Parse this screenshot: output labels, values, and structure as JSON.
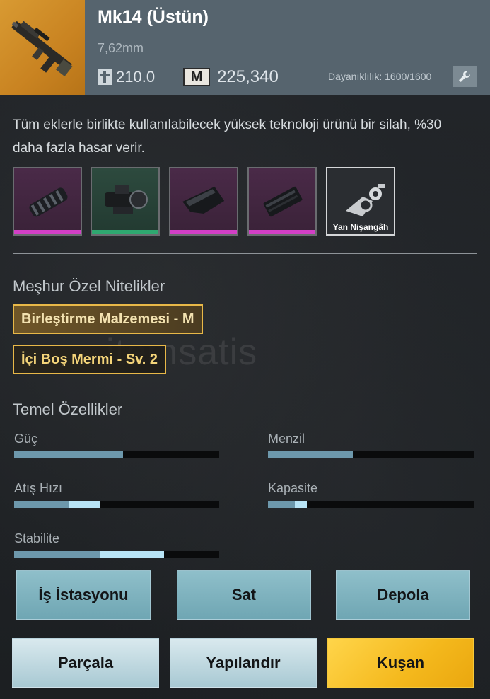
{
  "item": {
    "title": "Mk14 (Üstün)",
    "caliber": "7,62mm",
    "weight": "210.0",
    "currency_icon_label": "M",
    "price": "225,340",
    "durability": "Dayanıklılık: 1600/1600"
  },
  "description": "Tüm eklerle birlikte kullanılabilecek yüksek teknoloji ürünü bir silah, %30 daha fazla hasar verir.",
  "attachments": [
    {
      "name": "muzzle-compensator",
      "rarity": "pink"
    },
    {
      "name": "scope",
      "rarity": "green"
    },
    {
      "name": "stock",
      "rarity": "pink"
    },
    {
      "name": "magazine",
      "rarity": "pink"
    },
    {
      "name": "side-scope",
      "rarity": "empty",
      "label": "Yan Nişangâh"
    }
  ],
  "traits_section": {
    "title": "Meşhur Özel Nitelikler",
    "traits": [
      "Birleştirme Malzemesi - M",
      "İçi Boş Mermi - Sv. 2"
    ]
  },
  "stats_section": {
    "title": "Temel Özellikler",
    "stats": {
      "power": {
        "label": "Güç",
        "base": 0.53
      },
      "range": {
        "label": "Menzil",
        "base": 0.41
      },
      "fire_rate": {
        "label": "Atış Hızı",
        "base": 0.27,
        "bonus": 0.15
      },
      "capacity": {
        "label": "Kapasite",
        "base": 0.13,
        "bonus": 0.06
      },
      "stability": {
        "label": "Stabilite",
        "base": 0.42,
        "bonus": 0.31
      }
    }
  },
  "buttons": {
    "workbench": "İş İstasyonu",
    "sell": "Sat",
    "store": "Depola",
    "dismantle": "Parçala",
    "configure": "Yapılandır",
    "equip": "Kuşan"
  },
  "watermark": "itemsatis",
  "colors": {
    "header_bg": "#56646e",
    "thumb_bg": "#d89a32",
    "trait_border": "#e8b848",
    "bar_fill": "#6d98ac",
    "bar_bonus": "#b8e4f6",
    "pink_rarity": "#d23fc6",
    "green_rarity": "#2fa870",
    "equip_gold": "#f4b81c"
  }
}
